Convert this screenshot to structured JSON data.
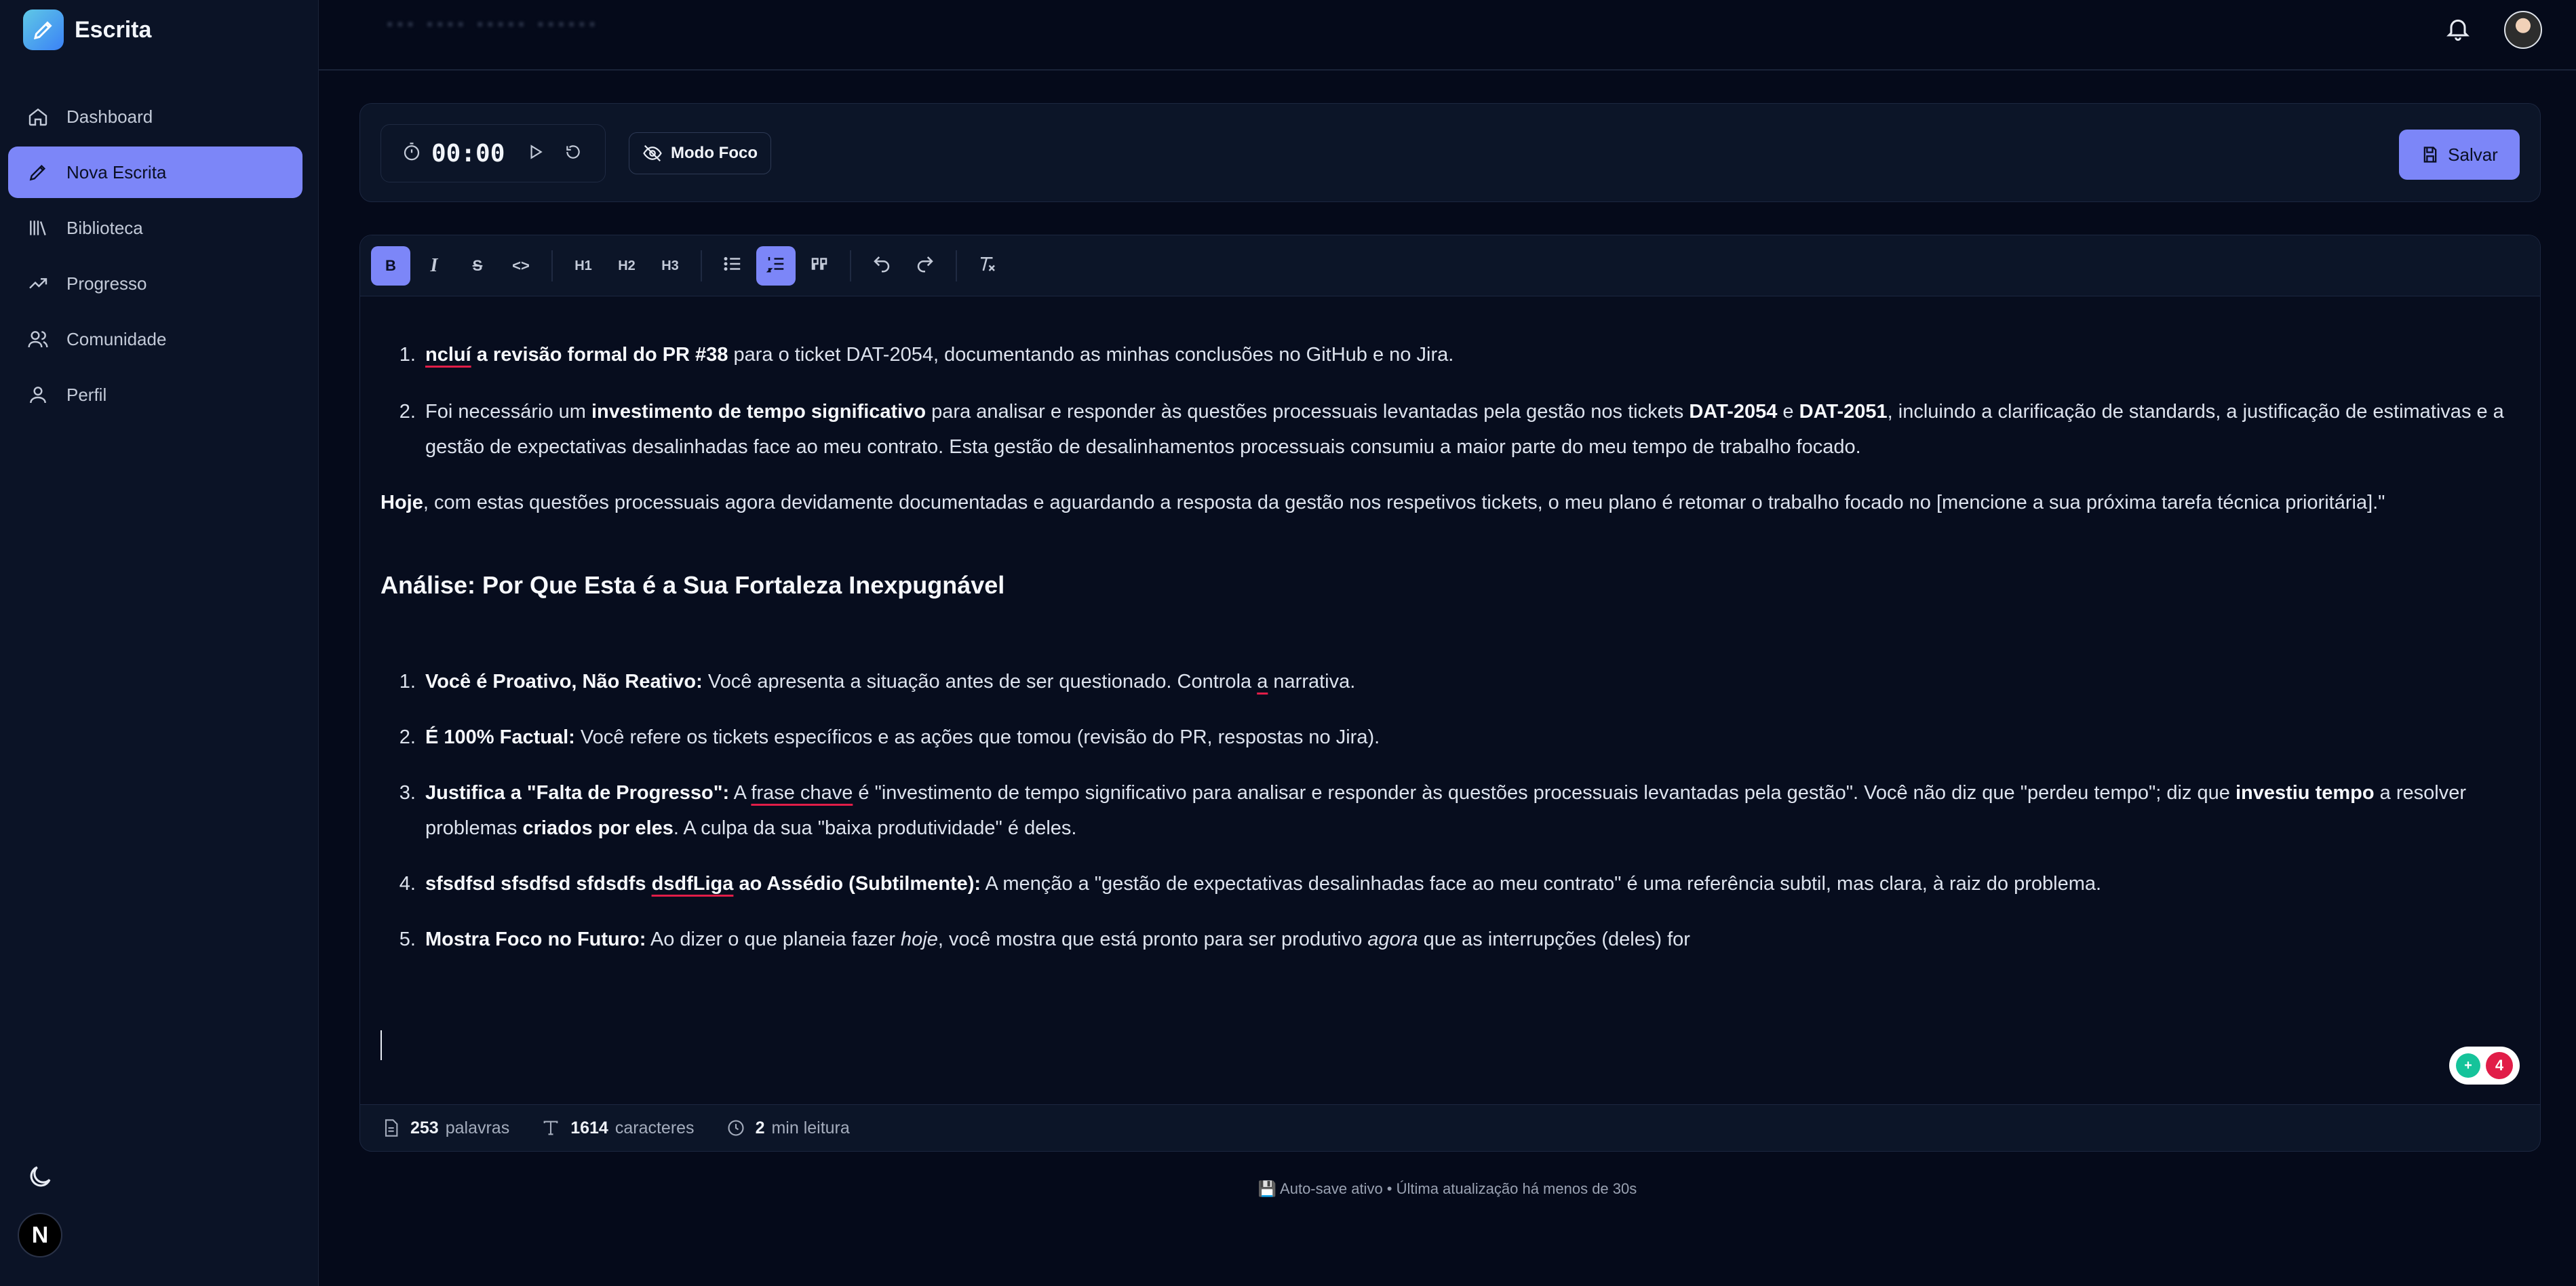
{
  "app": {
    "name": "Escrita"
  },
  "sidebar": {
    "items": [
      {
        "label": "Dashboard",
        "icon": "home-icon",
        "active": false
      },
      {
        "label": "Nova Escrita",
        "icon": "pen-icon",
        "active": true
      },
      {
        "label": "Biblioteca",
        "icon": "library-icon",
        "active": false
      },
      {
        "label": "Progresso",
        "icon": "trend-icon",
        "active": false
      },
      {
        "label": "Comunidade",
        "icon": "users-icon",
        "active": false
      },
      {
        "label": "Perfil",
        "icon": "user-icon",
        "active": false
      }
    ],
    "avatar_letter": "N"
  },
  "timer": {
    "value": "00:00"
  },
  "focus_mode": {
    "label": "Modo Foco"
  },
  "save": {
    "label": "Salvar"
  },
  "toolbar": {
    "h1": "H1",
    "h2": "H2",
    "h3": "H3"
  },
  "document": {
    "list1": [
      {
        "u": "ncluí",
        "b": " a revisão formal do PR #38",
        "t": " para o ticket DAT-2054, documentando as minhas conclusões no GitHub e no Jira."
      },
      {
        "t1": "Foi necessário um ",
        "b1": "investimento de tempo significativo",
        "t2": " para analisar e responder às questões processuais levantadas pela gestão nos tickets ",
        "b2": "DAT-2054",
        "t3": " e ",
        "b3": "DAT-2051",
        "t4": ", incluindo a clarificação de standards, a justificação de estimativas e a gestão de expectativas desalinhadas face ao meu contrato. Esta gestão de desalinhamentos processuais consumiu a maior parte do meu tempo de trabalho focado."
      }
    ],
    "para": {
      "b": "Hoje",
      "t": ", com estas questões processuais agora devidamente documentadas e aguardando a resposta da gestão nos respetivos tickets, o meu plano é retomar o trabalho focado no [mencione a sua próxima tarefa técnica prioritária].\""
    },
    "heading": "Análise: Por Que Esta é a Sua Fortaleza Inexpugnável",
    "list2": {
      "i1": {
        "b": "Você é Proativo, Não Reativo:",
        "t1": " Você apresenta a situação antes de ser questionado. Controla ",
        "u": "a",
        "t2": " narrativa."
      },
      "i2": {
        "b": "É 100% Factual:",
        "t": " Você refere os tickets específicos e as ações que tomou (revisão do PR, respostas no Jira)."
      },
      "i3": {
        "b1": "Justifica a \"Falta de Progresso\":",
        "t1": " A ",
        "u": "frase chave",
        "t2": " é \"investimento de tempo significativo para analisar e responder às questões processuais levantadas pela gestão\". Você não diz que \"perdeu tempo\"; diz que ",
        "b2": "investiu tempo",
        "t3": " a resolver problemas ",
        "b3": "criados por eles",
        "t4": ". A culpa da sua \"baixa produtividade\" é deles."
      },
      "i4": {
        "b1": " sfsdfsd sfsdfsd sfdsdfs ",
        "u": "dsdfLiga",
        "b2": " ao Assédio (Subtilmente):",
        "t": " A menção a \"gestão de expectativas desalinhadas face ao meu contrato\" é uma referência subtil, mas clara, à raiz do problema."
      },
      "i5": {
        "b": "Mostra Foco no Futuro:",
        "t1": " Ao dizer o que planeia fazer ",
        "i1": "hoje",
        "t2": ", você mostra que está pronto para ser produtivo ",
        "i2": "agora",
        "t3": " que as interrupções (deles) for"
      }
    }
  },
  "grammar": {
    "count": "4"
  },
  "stats": {
    "words_value": "253",
    "words_label": "palavras",
    "chars_value": "1614",
    "chars_label": "caracteres",
    "read_value": "2",
    "read_label": "min leitura"
  },
  "autosave": {
    "text": "💾 Auto-save ativo • Última atualização há menos de 30s"
  }
}
